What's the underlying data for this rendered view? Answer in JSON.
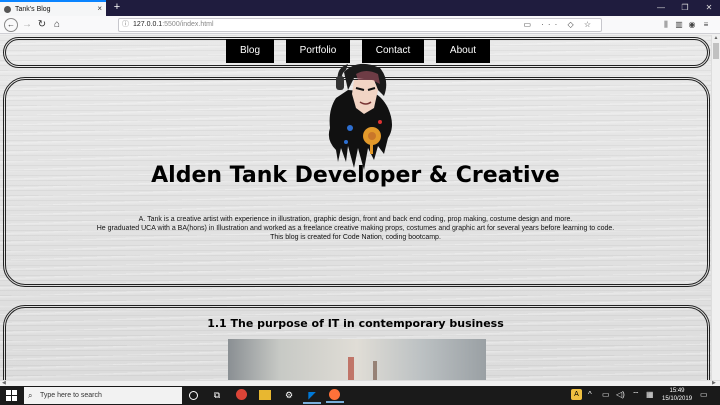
{
  "browser": {
    "tab_title": "Tank's Blog",
    "tab_close": "×",
    "new_tab": "+",
    "url_host": "127.0.0.1",
    "url_path": ":5500/index.html",
    "window_controls": [
      "—",
      "❐",
      "✕"
    ]
  },
  "site": {
    "nav": [
      "Blog",
      "Portfolio",
      "Contact",
      "About"
    ],
    "hero_title": "Alden Tank Developer & Creative",
    "hero_lines": [
      "A. Tank is a creative artist with experience in illustration, graphic design, front and back end coding, prop making, costume design and more.",
      "He graduated UCA with a BA(hons) in Illustration and worked as a freelance creative making props, costumes and graphic art for several years before learning to code.",
      "This blog is created for Code Nation, coding bootcamp."
    ],
    "post_title": "1.1 The purpose of IT in contemporary business"
  },
  "taskbar": {
    "search_placeholder": "Type here to search",
    "time": "15:49",
    "date": "15/10/2019",
    "tray_chevron": "^"
  },
  "colors": {
    "tab_accent": "#0a84ff",
    "title_bar": "#1f1c3e",
    "nav_button": "#000000",
    "taskbar": "#1a1a1a",
    "vscode": "#0078d7",
    "chrome_red": "#db4437",
    "firefox_orange": "#ff7139"
  }
}
